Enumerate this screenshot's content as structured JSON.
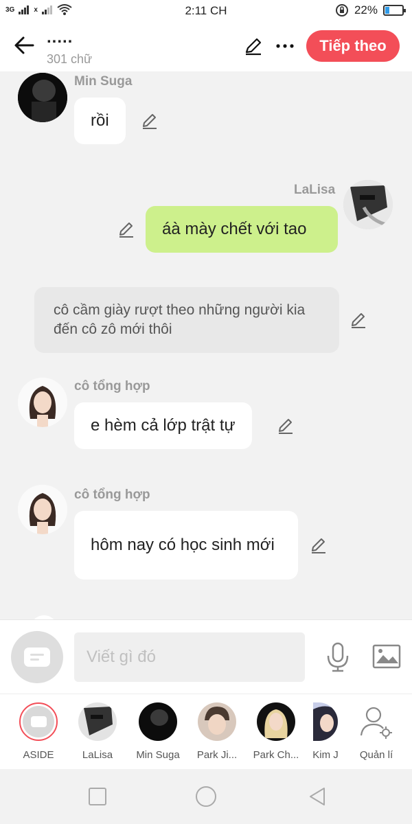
{
  "status": {
    "signal1": "3G",
    "signal2": "x",
    "time": "2:11 CH",
    "battery": "22%",
    "battery_level": 0.22
  },
  "header": {
    "title": ".....",
    "word_count": "301 chữ",
    "next_label": "Tiếp theo",
    "accent": "#f34e58"
  },
  "messages": [
    {
      "speaker": "Min Suga",
      "text": "rồi",
      "side": "left"
    },
    {
      "speaker": "LaLisa",
      "text": "áà mày chết với tao",
      "side": "right"
    },
    {
      "speaker": "",
      "text": "cô cầm giày rượt theo những người kia đến cô zô mới thôi",
      "side": "narration"
    },
    {
      "speaker": "cô tổng hợp",
      "text": "e hèm cả lớp trật tự",
      "side": "left"
    },
    {
      "speaker": "cô tổng hợp",
      "text": "hôm nay có học sinh mới",
      "side": "left"
    }
  ],
  "composer": {
    "placeholder": "Viết gì đó",
    "mic_icon": "microphone-icon",
    "image_icon": "image-icon"
  },
  "characters": [
    {
      "label": "ASIDE"
    },
    {
      "label": "LaLisa"
    },
    {
      "label": "Min Suga"
    },
    {
      "label": "Park Ji..."
    },
    {
      "label": "Park Ch..."
    },
    {
      "label": "Kim J"
    },
    {
      "label": "Quản lí"
    }
  ],
  "colors": {
    "bubble_green": "#cdf08c",
    "narration_bg": "#e8e8e8",
    "background": "#f2f2f2"
  }
}
